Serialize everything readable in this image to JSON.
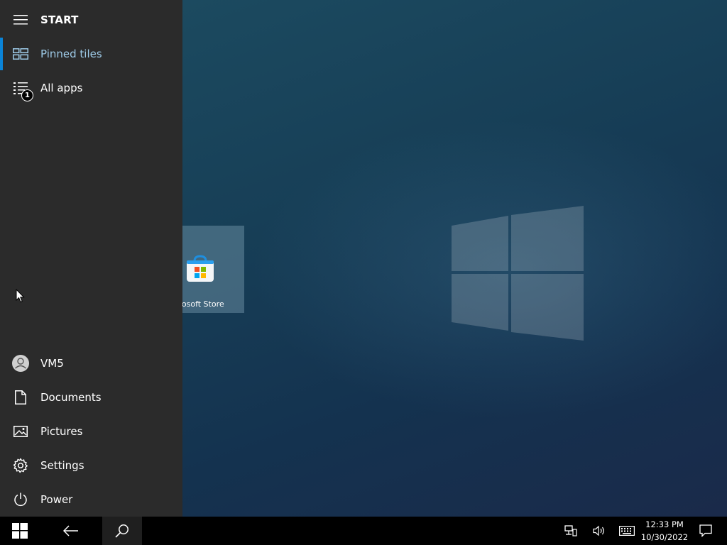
{
  "start": {
    "title": "START",
    "nav": [
      {
        "label": "Pinned tiles",
        "icon": "pinned-tiles-icon",
        "active": true
      },
      {
        "label": "All apps",
        "icon": "all-apps-icon",
        "badge": "1"
      }
    ],
    "bottom": [
      {
        "label": "VM5",
        "icon": "user-avatar-icon"
      },
      {
        "label": "Documents",
        "icon": "document-icon"
      },
      {
        "label": "Pictures",
        "icon": "pictures-icon"
      },
      {
        "label": "Settings",
        "icon": "gear-icon"
      },
      {
        "label": "Power",
        "icon": "power-icon"
      }
    ]
  },
  "tiles": [
    {
      "label": "Microsoft Store",
      "icon": "store-bag-icon"
    }
  ],
  "taskbar": {
    "time": "12:33 PM",
    "date": "10/30/2022",
    "tray_icons": [
      "network-icon",
      "volume-icon",
      "keyboard-icon",
      "notification-icon"
    ]
  },
  "colors": {
    "panel_bg": "#2b2b2b",
    "accent": "#0a84d8",
    "active_text": "#9ecbe8",
    "taskbar_bg": "#000000"
  }
}
